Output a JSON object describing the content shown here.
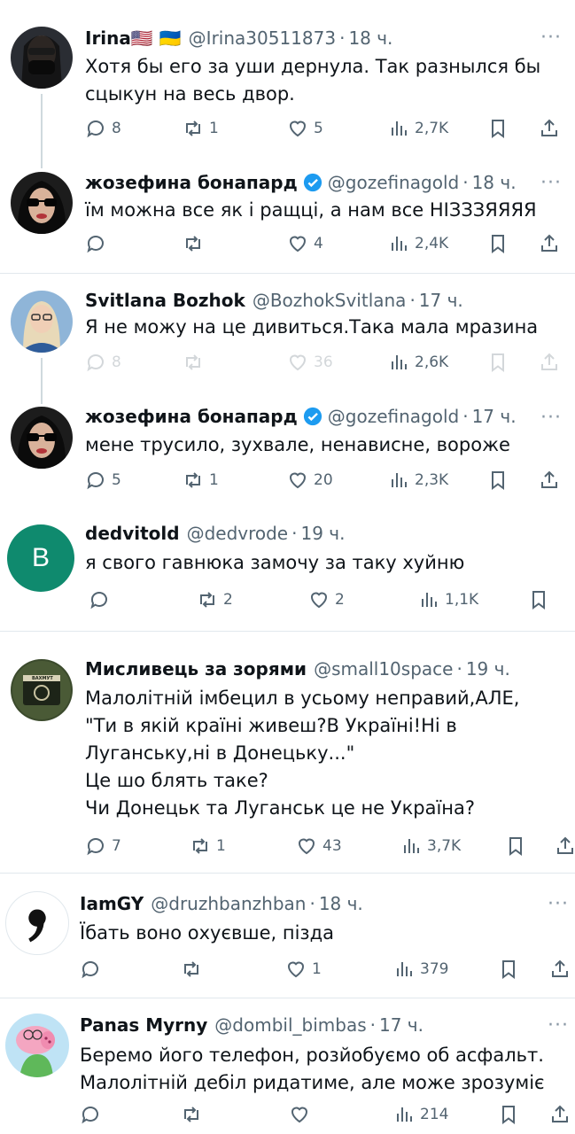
{
  "tweets": [
    {
      "name": "Irina🇺🇸 🇺🇦",
      "handle": "@Irina30511873",
      "time": "18 ч.",
      "lines": [
        "Хотя бы его за уши дернула. Так разнылся бы",
        "сцыкун на весь двор."
      ],
      "replies": "8",
      "retweets": "1",
      "likes": "5",
      "views": "2,7K"
    },
    {
      "name": "жозефина бонапард",
      "handle": "@gozefinagold",
      "time": "18 ч.",
      "lines": [
        "їм можна все як і ращці, а нам все НІЗЗЗЯЯЯЯ"
      ],
      "replies": "",
      "retweets": "",
      "likes": "4",
      "views": "2,4K"
    },
    {
      "name": "Svitlana Bozhok",
      "handle": "@BozhokSvitlana",
      "time": "17 ч.",
      "lines": [
        "Я не можу на це дивиться.Така мала мразина"
      ],
      "replies": "8",
      "retweets": "",
      "likes": "36",
      "views": "2,6K"
    },
    {
      "name": "жозефина бонапард",
      "handle": "@gozefinagold",
      "time": "17 ч.",
      "lines": [
        "мене трусило, зухвале, ненависне, вороже"
      ],
      "replies": "5",
      "retweets": "1",
      "likes": "20",
      "views": "2,3K"
    },
    {
      "name": "dedvitold",
      "handle": "@dedvrode",
      "time": "19 ч.",
      "avatar_letter": "B",
      "lines": [
        "я свого гавнюка замочу за таку хуйню"
      ],
      "replies": "",
      "retweets": "2",
      "likes": "2",
      "views": "1,1K"
    },
    {
      "name": "Мисливець за зорями",
      "handle": "@small10space",
      "time": "19 ч.",
      "avatar_text": "ВАХМУТ",
      "lines": [
        "Малолітній імбецил в усьому неправий,АЛЕ,",
        "\"Ти в якій країні живеш?В Україні!Ні в",
        "Луганську,ні в Донецьку...\"",
        "Це шо блять таке?",
        "Чи Донецьк та Луганськ це не Україна?"
      ],
      "replies": "7",
      "retweets": "1",
      "likes": "43",
      "views": "3,7K"
    },
    {
      "name": "IamGY",
      "handle": "@druzhbanzhban",
      "time": "18 ч.",
      "lines": [
        "Їбать воно охуєвше, пізда"
      ],
      "replies": "",
      "retweets": "",
      "likes": "1",
      "views": "379"
    },
    {
      "name": "Panas Myrny",
      "handle": "@dombil_bimbas",
      "time": "17 ч.",
      "lines": [
        "Беремо його телефон, розйобуємо об асфальт.",
        "Малолітній дебіл ридатиме, але може зрозуміє"
      ],
      "replies": "",
      "retweets": "",
      "likes": "",
      "views": "214"
    }
  ],
  "ui": {
    "separator": "·",
    "more": "···"
  },
  "colors": {
    "verified": "#1d9bf0",
    "avatar_b": "#0f8a6e",
    "muted": "#536471"
  }
}
